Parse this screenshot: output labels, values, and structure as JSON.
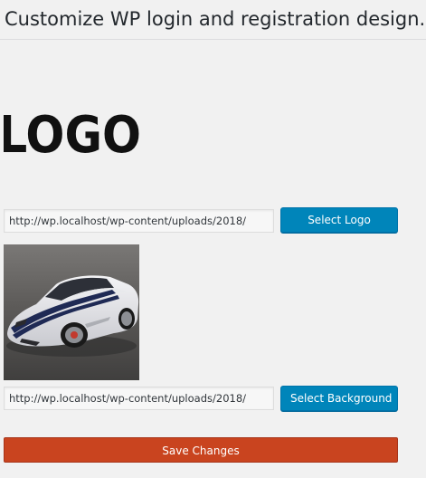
{
  "page": {
    "title": "Customize WP login and registration design."
  },
  "logo_section": {
    "logo_text": "LOGO",
    "url_value": "http://wp.localhost/wp-content/uploads/2018/",
    "button_label": "Select Logo"
  },
  "background_section": {
    "image_icon": "sports-car-photo",
    "url_value": "http://wp.localhost/wp-content/uploads/2018/",
    "button_label": "Select Background"
  },
  "actions": {
    "save_label": "Save Changes"
  },
  "colors": {
    "page_background": "#f1f1f1",
    "primary_button": "#0085ba",
    "save_button": "#c9441f",
    "logo": "#111111"
  }
}
